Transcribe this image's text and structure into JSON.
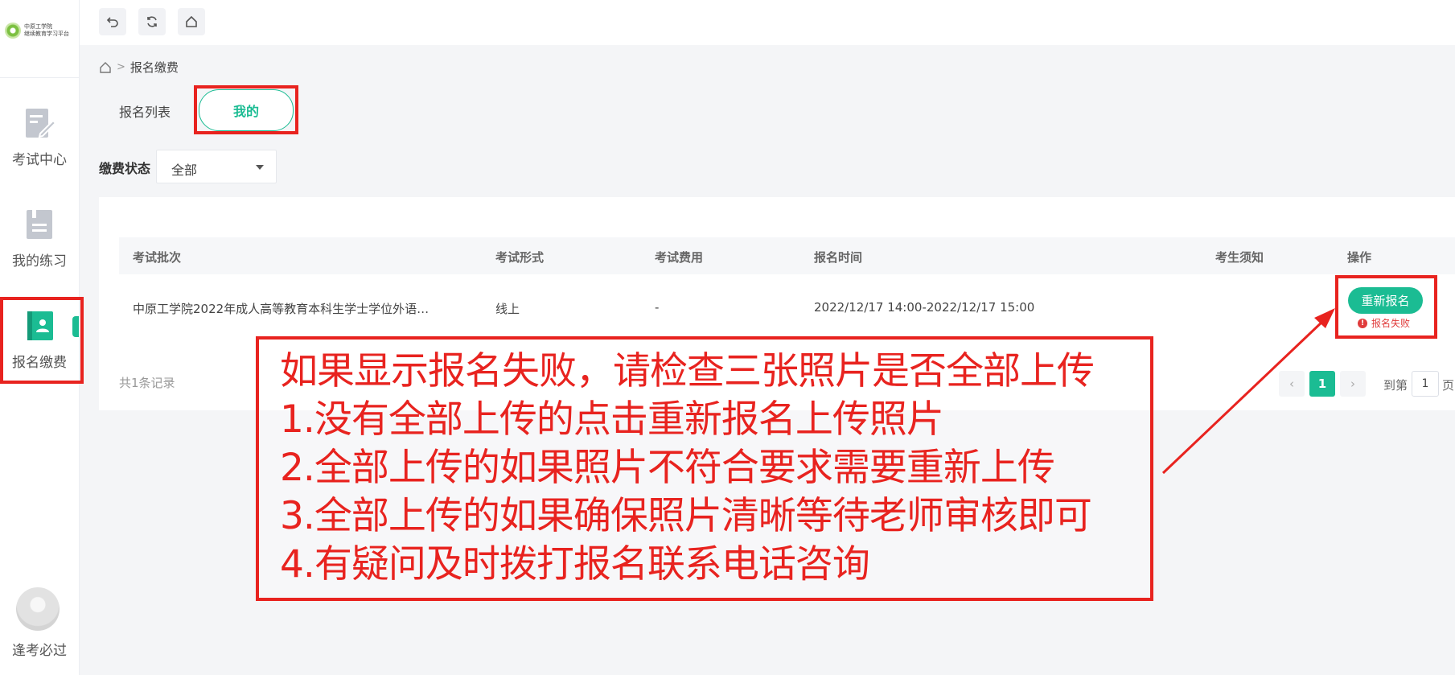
{
  "sidebar": {
    "logo_line1": "中原工学院",
    "logo_line2": "继续教育学习平台",
    "items": [
      {
        "label": "考试中心",
        "icon": "exam-edit-icon"
      },
      {
        "label": "我的练习",
        "icon": "practice-doc-icon"
      },
      {
        "label": "报名缴费",
        "icon": "registration-book-icon",
        "active": true
      }
    ],
    "user_name": "逢考必过"
  },
  "toolbar": {
    "icons": [
      "undo-icon",
      "refresh-icon",
      "home-icon"
    ]
  },
  "breadcrumb": {
    "icon": "home-icon",
    "separator": ">",
    "current": "报名缴费"
  },
  "tabs": {
    "list_label": "报名列表",
    "mine_label": "我的"
  },
  "filter": {
    "label": "缴费状态",
    "selected": "全部"
  },
  "table": {
    "headers": [
      "考试批次",
      "考试形式",
      "考试费用",
      "报名时间",
      "考生须知",
      "操作"
    ],
    "rows": [
      {
        "batch": "中原工学院2022年成人高等教育本科生学士学位外语…",
        "format": "线上",
        "fee": "-",
        "time": "2022/12/17 14:00-2022/12/17 15:00",
        "notice": "",
        "action_label": "重新报名",
        "status": "报名失败"
      }
    ]
  },
  "pagination": {
    "records": "共1条记录",
    "prev": "‹",
    "current": "1",
    "next": "›",
    "goto_label": "到第",
    "goto_value": "1",
    "page_suffix": "页"
  },
  "annotation": {
    "lines": [
      "如果显示报名失败，请检查三张照片是否全部上传",
      "1.没有全部上传的点击重新报名上传照片",
      "2.全部上传的如果照片不符合要求需要重新上传",
      "3.全部上传的如果确保照片清晰等待老师审核即可",
      "4.有疑问及时拨打报名联系电话咨询"
    ],
    "color": "#e8231f"
  },
  "colors": {
    "accent": "#1bbc93",
    "error": "#e03b3b",
    "annotation": "#e8231f"
  }
}
